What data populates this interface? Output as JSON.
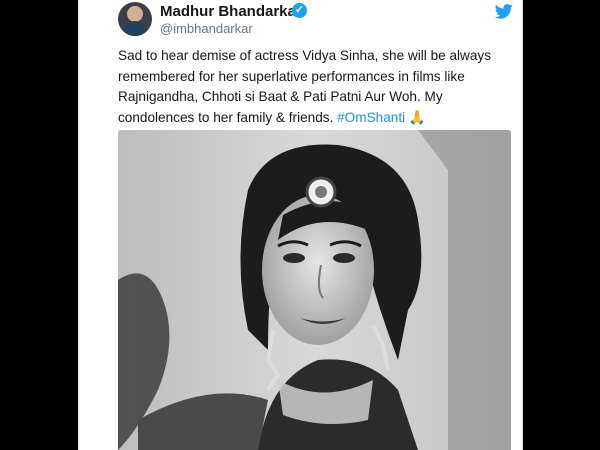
{
  "tweet": {
    "author_name": "Madhur Bhandarkar",
    "author_handle": "@imbhandarkar",
    "text_main": "Sad to hear demise of actress Vidya Sinha, she will be always remembered for her superlative performances in films like Rajnigandha, Chhoti si Baat & Pati Patni Aur Woh. My condolences to her family & friends. ",
    "hashtag": "#OmShanti",
    "emoji": "🙏"
  },
  "icons": {
    "verified": "verified-badge-icon",
    "brand": "twitter-bird-icon",
    "emoji": "folded-hands-icon"
  },
  "colors": {
    "link": "#1b95e0",
    "verified": "#1da1f2",
    "text": "#14171a",
    "muted": "#657786"
  }
}
